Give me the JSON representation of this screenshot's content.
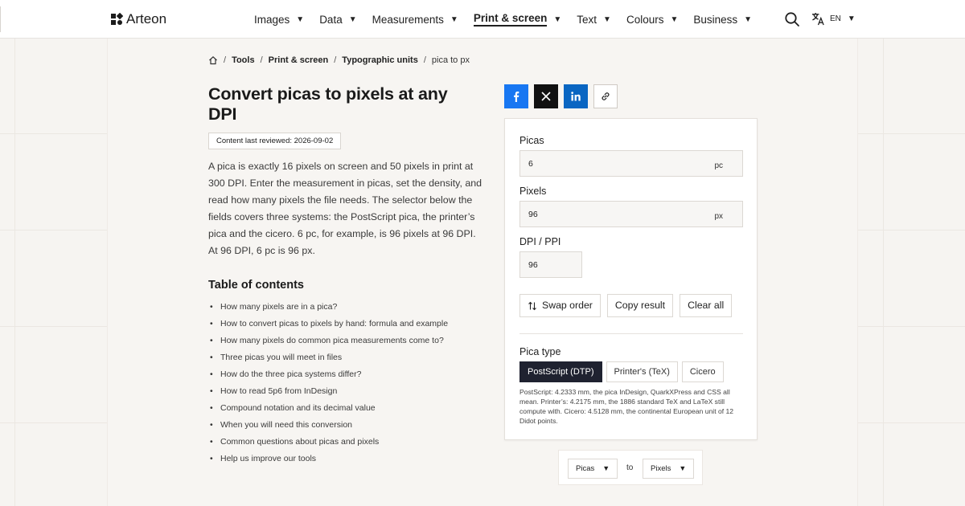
{
  "brand": {
    "name": "Arteon"
  },
  "nav": [
    {
      "label": "Images",
      "active": false
    },
    {
      "label": "Data",
      "active": false
    },
    {
      "label": "Measurements",
      "active": false
    },
    {
      "label": "Print & screen",
      "active": true
    },
    {
      "label": "Text",
      "active": false
    },
    {
      "label": "Colours",
      "active": false
    },
    {
      "label": "Business",
      "active": false
    }
  ],
  "language": {
    "code": "EN"
  },
  "breadcrumb": {
    "items": [
      "Tools",
      "Print & screen",
      "Typographic units"
    ],
    "current": "pica to px"
  },
  "article": {
    "title": "Convert picas to pixels at any DPI",
    "reviewed": "Content last reviewed: 2026-09-02",
    "intro": "A pica is exactly 16 pixels on screen and 50 pixels in print at 300 DPI. Enter the measurement in picas, set the density, and read how many pixels the file needs. The selector below the fields covers three systems: the PostScript pica, the printer’s pica and the cicero. 6 pc, for example, is 96 pixels at 96 DPI. At 96 DPI, 6 pc is 96 px."
  },
  "toc": {
    "title": "Table of contents",
    "items": [
      "How many pixels are in a pica?",
      "How to convert picas to pixels by hand: formula and example",
      "How many pixels do common pica measurements come to?",
      "Three picas you will meet in files",
      "How do the three pica systems differ?",
      "How to read 5p6 from InDesign",
      "Compound notation and its decimal value",
      "When you will need this conversion",
      "Common questions about picas and pixels",
      "Help us improve our tools"
    ]
  },
  "share": {
    "icons": [
      "facebook-icon",
      "x-icon",
      "linkedin-icon",
      "link-icon"
    ],
    "colors": {
      "facebook": "#1877f2",
      "x": "#111111",
      "linkedin": "#0a66c2"
    }
  },
  "converter": {
    "picas": {
      "label": "Picas",
      "value": "6",
      "unit": "pc"
    },
    "pixels": {
      "label": "Pixels",
      "value": "96",
      "unit": "px"
    },
    "dpi": {
      "label": "DPI / PPI",
      "value": "96"
    },
    "actions": {
      "swap": "Swap order",
      "copy": "Copy result",
      "clear": "Clear all"
    },
    "pica_type": {
      "label": "Pica type",
      "options": [
        "PostScript (DTP)",
        "Printer's (TeX)",
        "Cicero"
      ],
      "selected": "PostScript (DTP)",
      "note": "PostScript: 4.2333 mm, the pica InDesign, QuarkXPress and CSS all mean. Printer’s: 4.2175 mm, the 1886 standard TeX and LaTeX still compute with. Cicero: 4.5128 mm, the continental European unit of 12 Didot points."
    }
  },
  "unit_switch": {
    "from": "Picas",
    "to_label": "to",
    "to": "Pixels"
  }
}
